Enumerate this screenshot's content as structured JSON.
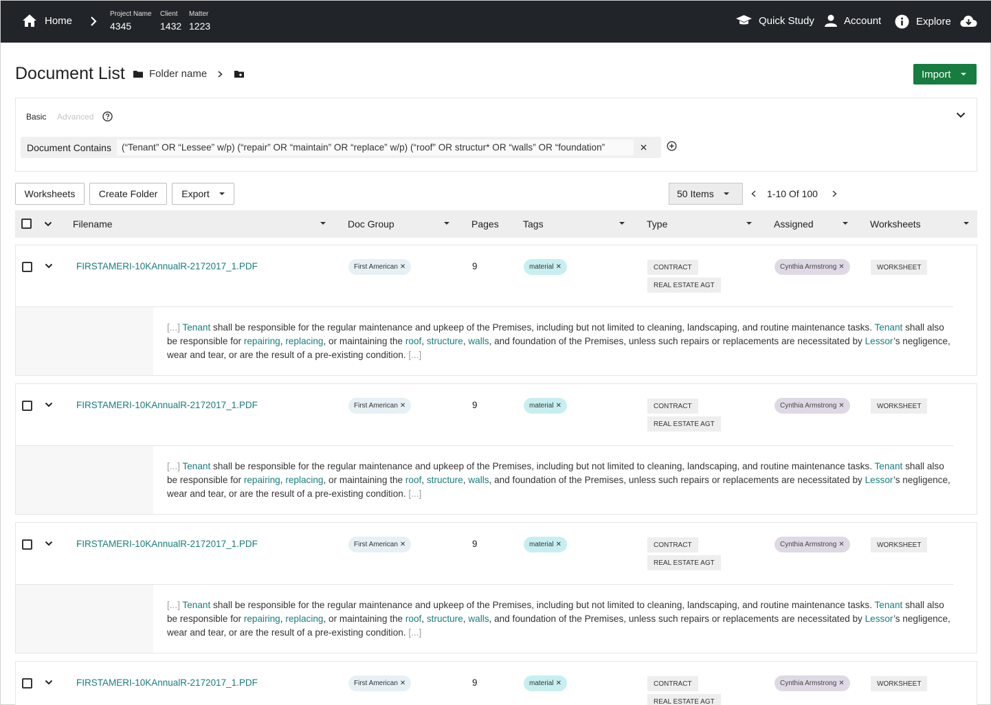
{
  "topbar": {
    "home_label": "Home",
    "meta": [
      {
        "label": "Project Name",
        "value": "4345"
      },
      {
        "label": "Client",
        "value": "1432"
      },
      {
        "label": "Matter",
        "value": "1223"
      }
    ],
    "quick_study": "Quick Study",
    "account": "Account",
    "explore": "Explore"
  },
  "header": {
    "title": "Document List",
    "folder_name": "Folder name",
    "import_label": "Import"
  },
  "filter": {
    "mode_basic": "Basic",
    "mode_advanced": "Advanced",
    "query_label": "Document Contains",
    "query_value": "(“Tenant” OR “Lessee” w/p) (“repair” OR “maintain” OR “replace” w/p) (“roof” OR structur* OR “walls” OR “foundation”"
  },
  "toolbar": {
    "worksheets": "Worksheets",
    "create_folder": "Create Folder",
    "export": "Export",
    "per_page": "50 Items",
    "range": "1-10 Of 100"
  },
  "columns": {
    "filename": "Filename",
    "doc_group": "Doc Group",
    "pages": "Pages",
    "tags": "Tags",
    "type": "Type",
    "assigned": "Assigned",
    "worksheets": "Worksheets"
  },
  "documents": [
    {
      "filename": "FIRSTAMERI-10KAnnualR-2172017_1.PDF",
      "doc_group": "First American",
      "pages": "9",
      "tag": "material",
      "type1": "CONTRACT",
      "type2": "REAL ESTATE AGT",
      "assigned": "Cynthia Armstrong",
      "worksheet": "WORKSHEET"
    },
    {
      "filename": "FIRSTAMERI-10KAnnualR-2172017_1.PDF",
      "doc_group": "First American",
      "pages": "9",
      "tag": "material",
      "type1": "CONTRACT",
      "type2": "REAL ESTATE AGT",
      "assigned": "Cynthia Armstrong",
      "worksheet": "WORKSHEET"
    },
    {
      "filename": "FIRSTAMERI-10KAnnualR-2172017_1.PDF",
      "doc_group": "First American",
      "pages": "9",
      "tag": "material",
      "type1": "CONTRACT",
      "type2": "REAL ESTATE AGT",
      "assigned": "Cynthia Armstrong",
      "worksheet": "WORKSHEET"
    },
    {
      "filename": "FIRSTAMERI-10KAnnualR-2172017_1.PDF",
      "doc_group": "First American",
      "pages": "9",
      "tag": "material",
      "type1": "CONTRACT",
      "type2": "REAL ESTATE AGT",
      "assigned": "Cynthia Armstrong",
      "worksheet": "WORKSHEET"
    }
  ],
  "snippet": {
    "ell": "[...]",
    "tenant": "Tenant",
    "t1": " shall be responsible for the regular maintenance and upkeep of the Premises, including but not limited to cleaning, landscaping, and routine maintenance tasks. ",
    "t2": " shall also be responsible for ",
    "repairing": "repairing",
    "comma": ", ",
    "replacing": "replacing",
    "t3": ", or maintaining the ",
    "roof": "roof",
    "structure": "structure",
    "walls": "walls",
    "t4": ", and foundation of the Premises, unless such repairs or replacements are necessitated by ",
    "lessor": "Lessor",
    "t5": "’s negligence, wear and tear, or are the result of a pre-existing condition. "
  },
  "colors": {
    "topbar": "#212529",
    "accent_teal": "#177d7c",
    "import_green": "#177c3f"
  },
  "icons": [
    "home-icon",
    "chevron-right-icon",
    "graduation-cap-icon",
    "user-icon",
    "info-icon",
    "cloud-download-icon",
    "folder-icon",
    "folder-plus-icon",
    "help-icon",
    "chevron-down-icon",
    "close-icon",
    "add-circle-icon"
  ]
}
